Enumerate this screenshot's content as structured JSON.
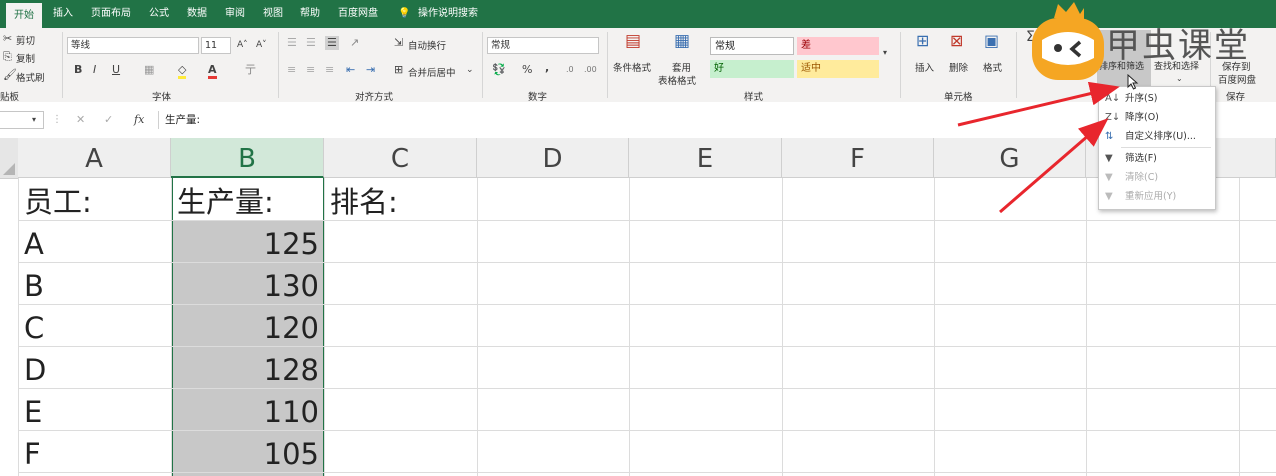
{
  "tabs": [
    "开始",
    "插入",
    "页面布局",
    "公式",
    "数据",
    "审阅",
    "视图",
    "帮助",
    "百度网盘",
    "操作说明搜索"
  ],
  "clipboard": {
    "cut": "剪切",
    "copy": "复制",
    "format_painter": "格式刷",
    "group": "贴板"
  },
  "font": {
    "name": "等线",
    "size": "11",
    "group": "字体",
    "bold": "B",
    "italic": "I",
    "underline": "U"
  },
  "alignment": {
    "wrap": "自动换行",
    "merge": "合并后居中",
    "group": "对齐方式"
  },
  "number": {
    "format": "常规",
    "percent": "%",
    "comma": ",",
    "group": "数字"
  },
  "styles": {
    "conditional": "条件格式",
    "table_format_1": "套用",
    "table_format_2": "表格格式",
    "normal": "常规",
    "bad": "差",
    "good": "好",
    "neutral": "适中",
    "group": "样式"
  },
  "cells": {
    "insert": "插入",
    "delete": "删除",
    "format": "格式",
    "group": "单元格"
  },
  "editing": {
    "sum": "Σ",
    "sort_filter": "排序和筛选",
    "find_select": "查找和选择"
  },
  "save": {
    "label_1": "保存到",
    "label_2": "百度网盘",
    "group": "保存"
  },
  "watermark": "甲虫课堂",
  "formula_bar": {
    "fx": "fx",
    "content": "生产量:"
  },
  "columns": [
    "A",
    "B",
    "C",
    "D",
    "E",
    "F",
    "G"
  ],
  "rows": [
    {
      "a": "员工:",
      "b": "生产量:",
      "c": "排名:"
    },
    {
      "a": "A",
      "b": "125"
    },
    {
      "a": "B",
      "b": "130"
    },
    {
      "a": "C",
      "b": "120"
    },
    {
      "a": "D",
      "b": "128"
    },
    {
      "a": "E",
      "b": "110"
    },
    {
      "a": "F",
      "b": "105"
    }
  ],
  "sort_menu": {
    "items": [
      {
        "icon": "A↓",
        "label": "升序(S)"
      },
      {
        "icon": "Z↓",
        "label": "降序(O)"
      },
      {
        "icon": "⇅",
        "label": "自定义排序(U)..."
      },
      {
        "icon": "▼",
        "label": "筛选(F)"
      },
      {
        "icon": "▼",
        "label": "清除(C)"
      },
      {
        "icon": "▼",
        "label": "重新应用(Y)"
      }
    ]
  },
  "colors": {
    "excel_green": "#217346",
    "selected_header": "#d2e8d9",
    "selection_fill": "#c8c8c8",
    "arrow_red": "#e8262d"
  }
}
